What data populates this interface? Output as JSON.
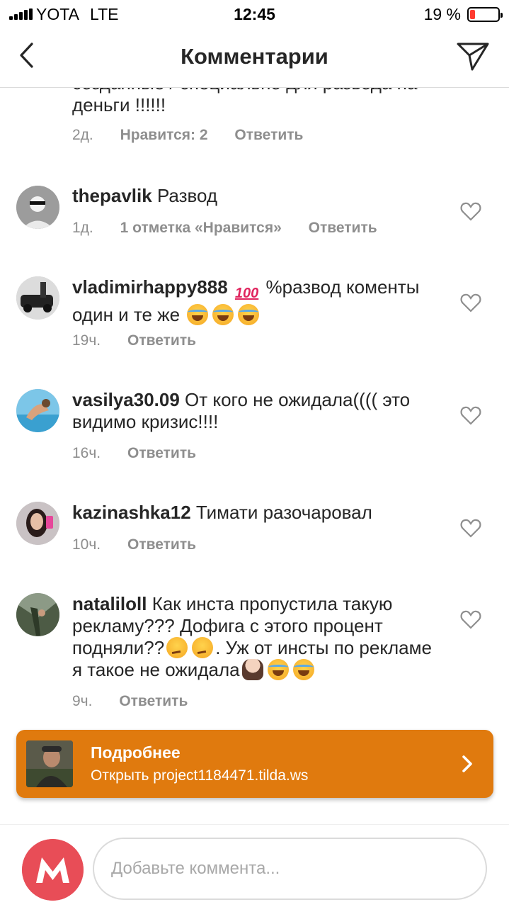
{
  "status_bar": {
    "carrier": "YOTA",
    "network": "LTE",
    "time": "12:45",
    "battery_percent": "19 %",
    "battery_level": 0.19,
    "battery_color": "#ff3b30"
  },
  "nav": {
    "title": "Комментарии",
    "back_icon": "chevron-left-icon",
    "send_icon": "paper-plane-icon"
  },
  "partial_comment": {
    "text": "созданные / специально для развода на деньги !!!!!!",
    "time": "2д.",
    "likes": "Нравится: 2",
    "reply": "Ответить"
  },
  "comments": [
    {
      "username": "thepavlik",
      "text": "Развод",
      "time": "1д.",
      "likes": "1 отметка «Нравится»",
      "reply": "Ответить"
    },
    {
      "username": "vladimirhappy888",
      "text_a": " ",
      "text_b": " %развод коменты один и те же ",
      "time": "19ч.",
      "reply": "Ответить"
    },
    {
      "username": "vasilya30.09",
      "text": "От кого не ожидала(((( это видимо кризис!!!!",
      "time": "16ч.",
      "reply": "Ответить"
    },
    {
      "username": "kazinashka12",
      "text": "Тимати разочаровал",
      "time": "10ч.",
      "reply": "Ответить"
    },
    {
      "username": "natalіloll",
      "text_a": "Как инста пропустила такую рекламу??? Дофига с этого процент подняли??",
      "text_b": ". Уж от инсты по рекламе я такое не ожидала",
      "time": "9ч.",
      "reply": "Ответить"
    }
  ],
  "ad": {
    "title": "Подробнее",
    "subtitle": "Открыть project1184471.tilda.ws",
    "color": "#e07a0e"
  },
  "composer": {
    "placeholder": "Добавьте коммента...",
    "avatar_color": "#e84d57"
  }
}
